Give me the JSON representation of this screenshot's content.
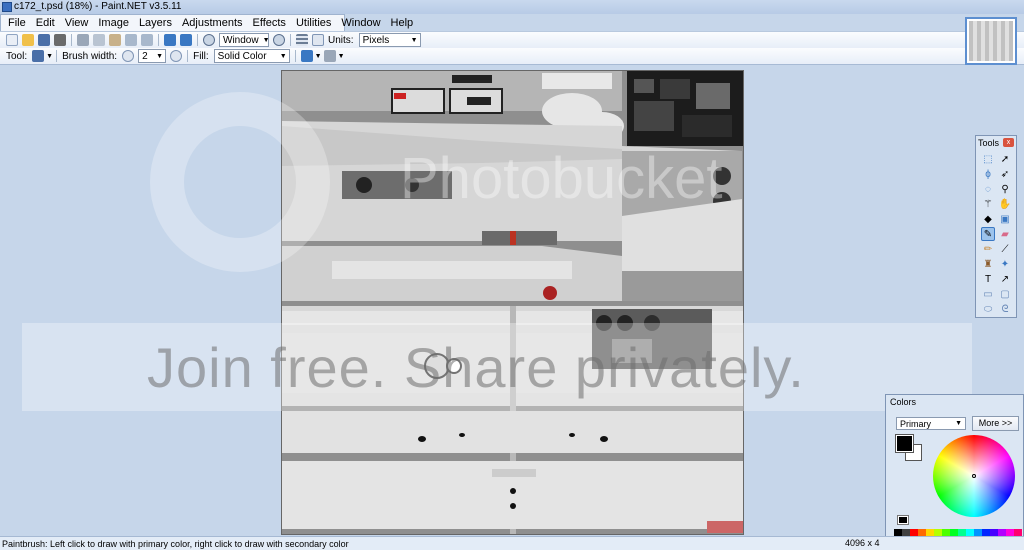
{
  "window": {
    "title": "c172_t.psd (18%) - Paint.NET v3.5.11"
  },
  "menu": {
    "items": [
      "File",
      "Edit",
      "View",
      "Image",
      "Layers",
      "Adjustments",
      "Effects",
      "Utilities",
      "Window",
      "Help"
    ]
  },
  "toolbar1": {
    "zoom_mode": "Window",
    "units_label": "Units:",
    "units_value": "Pixels"
  },
  "toolbar2": {
    "tool_label": "Tool:",
    "brush_width_label": "Brush width:",
    "brush_width_value": "2",
    "fill_label": "Fill:",
    "fill_value": "Solid Color"
  },
  "watermark": {
    "brand": "Photobucket",
    "tagline": "Join free. Share privately."
  },
  "tools_window": {
    "title": "Tools",
    "close": "x",
    "icons": [
      "rectangle-select-icon",
      "move-selection-icon",
      "lasso-select-icon",
      "move-selected-icon",
      "ellipse-select-icon",
      "zoom-icon",
      "magic-wand-icon",
      "pan-icon",
      "paint-bucket-icon",
      "gradient-icon",
      "paintbrush-icon",
      "eraser-icon",
      "pencil-icon",
      "color-picker-icon",
      "clone-stamp-icon",
      "recolor-icon",
      "text-icon",
      "line-curve-icon",
      "rectangle-shape-icon",
      "rounded-rectangle-icon",
      "ellipse-shape-icon",
      "freeform-shape-icon"
    ]
  },
  "colors_window": {
    "title": "Colors",
    "mode": "Primary",
    "more_button": "More >>",
    "primary_color": "#000000",
    "secondary_color": "#ffffff",
    "palette": [
      "#000000",
      "#404040",
      "#ff0000",
      "#ff6a00",
      "#ffd800",
      "#b6ff00",
      "#4cff00",
      "#00ff21",
      "#00ff90",
      "#00ffff",
      "#0094ff",
      "#0026ff",
      "#4800ff",
      "#b200ff",
      "#ff00dc",
      "#ff006e"
    ]
  },
  "status": {
    "message": "Paintbrush: Left click to draw with primary color, right click to draw with secondary color",
    "image_size": "4096 x 4"
  }
}
